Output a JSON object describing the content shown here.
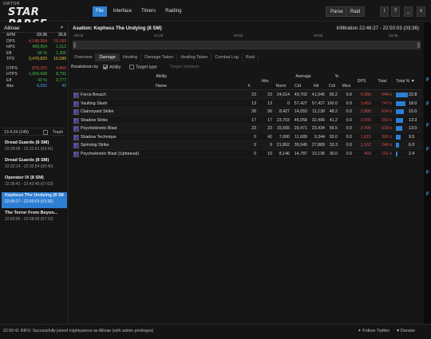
{
  "app": {
    "logo_small": "SWTOR",
    "logo_big": "STAR PARSE"
  },
  "menu": [
    "File",
    "Interface",
    "Timers",
    "Raiding"
  ],
  "toolbar": {
    "parse": "Parse",
    "raid": "Raid",
    "info": "i",
    "help": "?",
    "min": "_",
    "close": "x"
  },
  "left": {
    "player": "Allinae",
    "stats": [
      {
        "k": "APM",
        "v1": "03:36",
        "v2": "35.8",
        "c1": "white",
        "c2": "white"
      },
      {
        "k": "DPS",
        "v1": "4,148,064",
        "v2": "19,189",
        "c1": "red",
        "c2": "red"
      },
      {
        "k": "HPS",
        "v1": "499,954",
        "v2": "2,312",
        "c1": "green",
        "c2": "green"
      },
      {
        "k": "Eff",
        "v1": "56 %",
        "v2": "1,306",
        "c1": "green",
        "c2": "green"
      },
      {
        "k": "TPS",
        "v1": "3,478,820",
        "v2": "16,089",
        "c1": "yellow",
        "c2": "yellow"
      },
      {
        "k": "DTPS",
        "v1": "878,255",
        "v2": "4,866",
        "c1": "red",
        "c2": "red"
      },
      {
        "k": "HTPS",
        "v1": "1,900,698",
        "v2": "8,791",
        "c1": "green",
        "c2": "green"
      },
      {
        "k": "Eff",
        "v1": "43 %",
        "v2": "3,777",
        "c1": "green",
        "c2": "green"
      },
      {
        "k": "Abs",
        "v1": "8,552",
        "v2": "40",
        "c1": "blue",
        "c2": "blue"
      }
    ],
    "timestamp": "13.4.24 (149)",
    "trash": "Trash",
    "encounters": [
      {
        "title": "Dread Guards (8 SM)",
        "dur": "22:28:09 - 22:31:51 (03:41)"
      },
      {
        "title": "Dread Guards (8 SM)",
        "dur": "22:32:14 - 22:32:54 (00:40)"
      },
      {
        "title": "Operator IX (8 SM)",
        "dur": "22:36:41 - 22:43:45 (07:03)"
      },
      {
        "title": "Kephess The Undying (8 SM)",
        "dur": "22:46:27 - 22:50:03 (03:36)"
      },
      {
        "title": "The Terror From Beyon...",
        "dur": "22:50:56 - 22:58:09 (07:10)"
      }
    ]
  },
  "main": {
    "title": "Asation: Kephess The Undying (8 SM)",
    "range": "Infiltration 22:46:27 - 22:50:03 (03:36)",
    "timeline": [
      "00:00",
      "01:00",
      "02:00",
      "03:00",
      "03:36"
    ],
    "tabs": [
      "Overview",
      "Damage",
      "Healing",
      "Damage Taken",
      "Healing Taken",
      "Combat Log",
      "Raid"
    ],
    "breakdown": "Breakdown by",
    "ability_opt": "Ability",
    "target_opt": "Target type",
    "instance_opt": "Target instance",
    "headers": {
      "ability": "Ability",
      "name": "Name",
      "count": "#",
      "hits": "Hits",
      "average": "Average",
      "norm": "Norm",
      "crit": "Crit",
      "hit": "Hit",
      "pct": "%",
      "critp": "Crit",
      "miss": "Miss",
      "dps": "DPS",
      "total": "Total",
      "totalp": "Total %"
    },
    "rows": [
      {
        "name": "Force Breach",
        "n": "23",
        "hits": "23",
        "norm": "24,614",
        "crit": "49,702",
        "hit": "41,045",
        "critp": "65.2",
        "miss": "0.0",
        "dps": "4,366",
        "total": "944 k",
        "pct": "22.8",
        "frac": 0.228
      },
      {
        "name": "Vaulting Slash",
        "n": "13",
        "hits": "13",
        "norm": "0",
        "crit": "57,427",
        "hit": "57,427",
        "critp": "100.0",
        "miss": "0.0",
        "dps": "3,453",
        "total": "747 k",
        "pct": "18.0",
        "frac": 0.18
      },
      {
        "name": "Clairvoyant Strike",
        "n": "28",
        "hits": "56",
        "norm": "8,427",
        "crit": "14,053",
        "hit": "11,139",
        "critp": "48.2",
        "miss": "0.0",
        "dps": "2,885",
        "total": "624 k",
        "pct": "15.0",
        "frac": 0.15
      },
      {
        "name": "Shadow Strike",
        "n": "17",
        "hits": "17",
        "norm": "23,703",
        "crit": "45,058",
        "hit": "32,496",
        "critp": "41.2",
        "miss": "0.0",
        "dps": "2,555",
        "total": "552 k",
        "pct": "13.3",
        "frac": 0.133
      },
      {
        "name": "Psychokinetic Blast",
        "n": "23",
        "hits": "23",
        "norm": "15,565",
        "crit": "29,471",
        "hit": "23,434",
        "critp": "56.5",
        "miss": "0.0",
        "dps": "2,495",
        "total": "539 k",
        "pct": "13.0",
        "frac": 0.13
      },
      {
        "name": "Shadow Technique",
        "n": "0",
        "hits": "42",
        "norm": "7,000",
        "crit": "11,689",
        "hit": "9,344",
        "critp": "50.0",
        "miss": "0.0",
        "dps": "1,815",
        "total": "392 k",
        "pct": "9.5",
        "frac": 0.095
      },
      {
        "name": "Spinning Strike",
        "n": "9",
        "hits": "9",
        "norm": "21,862",
        "crit": "39,945",
        "hit": "27,889",
        "critp": "33.3",
        "miss": "0.0",
        "dps": "1,162",
        "total": "249 k",
        "pct": "6.0",
        "frac": 0.06
      },
      {
        "name": "Psychokinetic Blast (Upheaval)",
        "n": "0",
        "hits": "10",
        "norm": "8,146",
        "crit": "14,787",
        "hit": "10,136",
        "critp": "30.0",
        "miss": "0.0",
        "dps": "469",
        "total": "101 k",
        "pct": "2.4",
        "frac": 0.024
      }
    ]
  },
  "side_labels": [
    "F",
    "F",
    "F",
    "F",
    "F",
    "F"
  ],
  "status": {
    "msg": "22:50:41 INFO: Successfully joined mightysense as Allinae (with admin privileges)",
    "twitter": "Follow Twitter",
    "donate": "Donate"
  }
}
